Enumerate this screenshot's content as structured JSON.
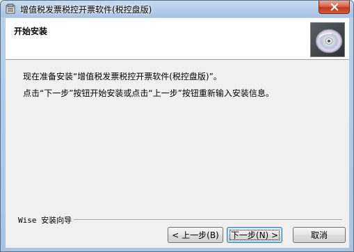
{
  "window": {
    "title": "增值税发票税控开票软件(税控盘版)"
  },
  "header": {
    "title": "开始安装"
  },
  "body": {
    "line1": "现在准备安装“增值税发票税控开票软件(税控盘版)”。",
    "line2": "点击“下一步”按钮开始安装或点击“上一步”按钮重新输入安装信息。"
  },
  "footer": {
    "brand": "Wise 安装向导"
  },
  "buttons": {
    "back": "< 上一步(B)",
    "next": "下一步(N) >",
    "cancel": "取消"
  },
  "icons": {
    "app": "installer-icon",
    "close": "close-icon",
    "cd": "cd-disc-icon"
  },
  "colors": {
    "close_button": "#c4381d",
    "title_bar": "#b9d1ea",
    "dialog_bg": "#f0f0f0"
  }
}
